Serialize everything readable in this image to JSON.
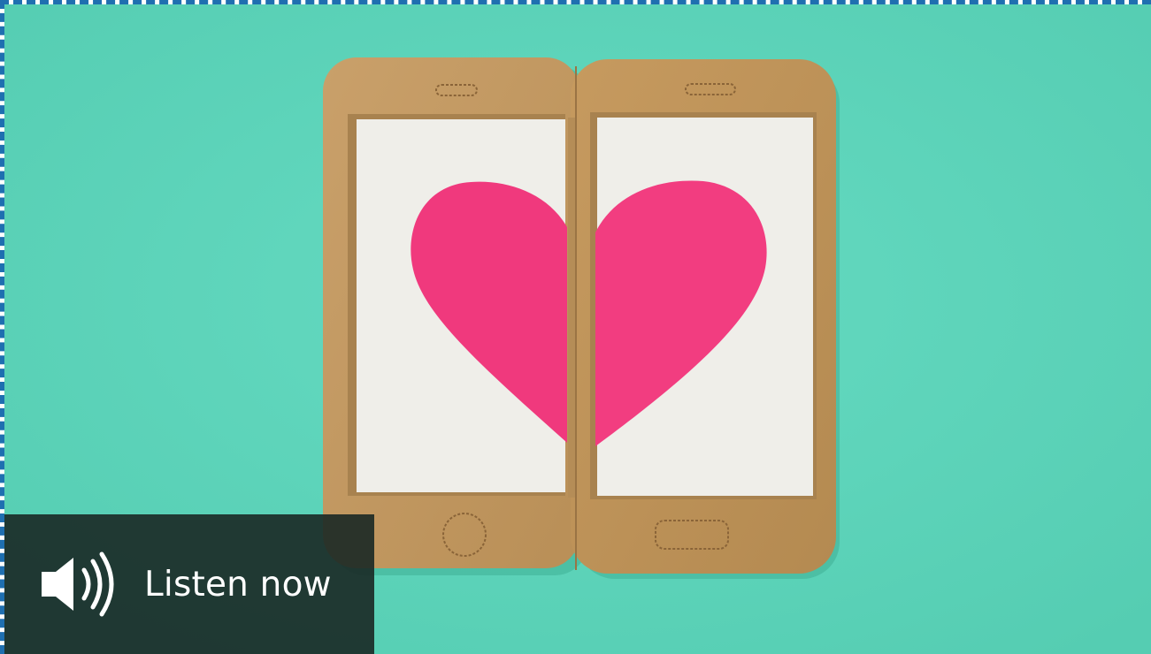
{
  "listen": {
    "label": "Listen now",
    "icon": "speaker-volume-icon"
  },
  "colors": {
    "background": "#5fd6bc",
    "cardboard": "#c79d63",
    "screen": "#efeee9",
    "heart": "#f0397d",
    "overlay": "#1a2825",
    "frame_border": "#1f6fb0"
  }
}
